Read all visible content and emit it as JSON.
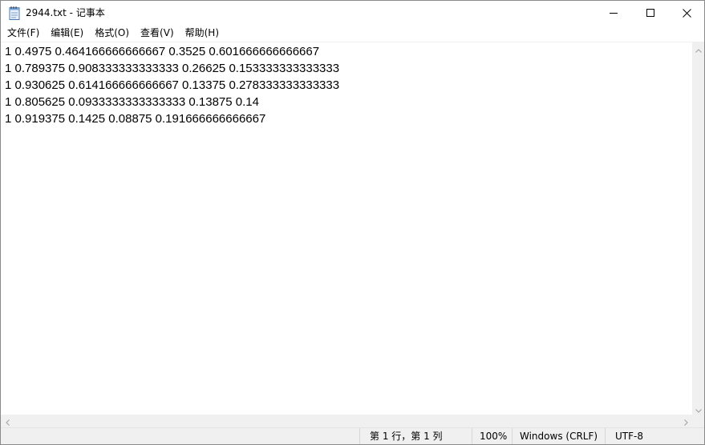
{
  "window": {
    "title": "2944.txt - 记事本",
    "icon": "notepad-icon",
    "controls": {
      "minimize": "minimize-icon",
      "maximize": "maximize-icon",
      "close": "close-icon"
    }
  },
  "menu": [
    {
      "label": "文件(F)"
    },
    {
      "label": "编辑(E)"
    },
    {
      "label": "格式(O)"
    },
    {
      "label": "查看(V)"
    },
    {
      "label": "帮助(H)"
    }
  ],
  "editor": {
    "lines": [
      "1 0.4975 0.464166666666667 0.3525 0.601666666666667",
      "1 0.789375 0.908333333333333 0.26625 0.153333333333333",
      "1 0.930625 0.614166666666667 0.13375 0.278333333333333",
      "1 0.805625 0.0933333333333333 0.13875 0.14",
      "1 0.919375 0.1425 0.08875 0.191666666666667"
    ]
  },
  "status": {
    "position": "第 1 行，第 1 列",
    "zoom": "100%",
    "line_ending": "Windows (CRLF)",
    "encoding": "UTF-8"
  },
  "colors": {
    "window_bg": "#ffffff",
    "bar_bg": "#f0f0f0",
    "border": "#8a8a8a"
  }
}
